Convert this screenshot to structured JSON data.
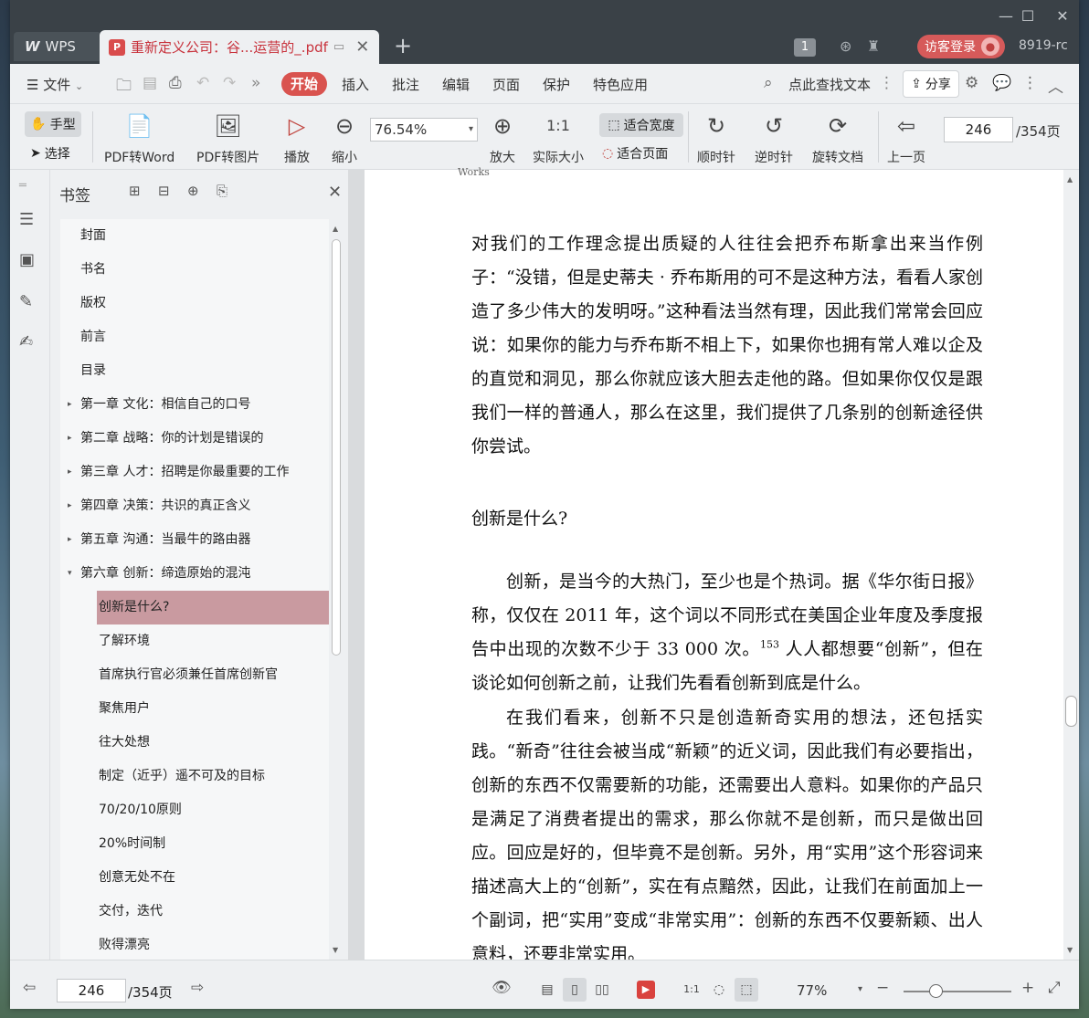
{
  "titlebar": {
    "app_tab": "WPS",
    "doc_tab": "重新定义公司：谷...运营的_.pdf",
    "tab_count": "1",
    "guest_login": "访客登录",
    "version": "8919-rc"
  },
  "menubar": {
    "file": "文件",
    "tabs": [
      "开始",
      "插入",
      "批注",
      "编辑",
      "页面",
      "保护",
      "特色应用"
    ],
    "search": "点此查找文本",
    "share": "分享"
  },
  "toolbar": {
    "hand": "手型",
    "select": "选择",
    "pdf_to_word": "PDF转Word",
    "pdf_to_image": "PDF转图片",
    "play": "播放",
    "zoom_out": "缩小",
    "zoom_value": "76.54%",
    "zoom_in": "放大",
    "actual_size": "实际大小",
    "fit_width": "适合宽度",
    "fit_page": "适合页面",
    "clockwise": "顺时针",
    "counterclockwise": "逆时针",
    "rotate_doc": "旋转文档",
    "prev_page": "上一页",
    "page_current": "246",
    "page_total": "/354页"
  },
  "bookmarks": {
    "title": "书签",
    "items": [
      {
        "label": "封面",
        "level": 0,
        "twisty": ""
      },
      {
        "label": "书名",
        "level": 0,
        "twisty": ""
      },
      {
        "label": "版权",
        "level": 0,
        "twisty": ""
      },
      {
        "label": "前言",
        "level": 0,
        "twisty": ""
      },
      {
        "label": "目录",
        "level": 0,
        "twisty": ""
      },
      {
        "label": "第一章  文化：相信自己的口号",
        "level": 0,
        "twisty": "▸"
      },
      {
        "label": "第二章  战略：你的计划是错误的",
        "level": 0,
        "twisty": "▸"
      },
      {
        "label": "第三章  人才：招聘是你最重要的工作",
        "level": 0,
        "twisty": "▸"
      },
      {
        "label": "第四章  决策：共识的真正含义",
        "level": 0,
        "twisty": "▸"
      },
      {
        "label": "第五章  沟通：当最牛的路由器",
        "level": 0,
        "twisty": "▸"
      },
      {
        "label": "第六章  创新：缔造原始的混沌",
        "level": 0,
        "twisty": "▾"
      },
      {
        "label": "创新是什么?",
        "level": 1,
        "twisty": "",
        "selected": true
      },
      {
        "label": "了解环境",
        "level": 1,
        "twisty": ""
      },
      {
        "label": "首席执行官必须兼任首席创新官",
        "level": 1,
        "twisty": ""
      },
      {
        "label": "聚焦用户",
        "level": 1,
        "twisty": ""
      },
      {
        "label": "往大处想",
        "level": 1,
        "twisty": ""
      },
      {
        "label": "制定（近乎）遥不可及的目标",
        "level": 1,
        "twisty": ""
      },
      {
        "label": "70/20/10原则",
        "level": 1,
        "twisty": ""
      },
      {
        "label": "20%时间制",
        "level": 1,
        "twisty": ""
      },
      {
        "label": "创意无处不在",
        "level": 1,
        "twisty": ""
      },
      {
        "label": "交付，迭代",
        "level": 1,
        "twisty": ""
      },
      {
        "label": "败得漂亮",
        "level": 1,
        "twisty": ""
      }
    ]
  },
  "document": {
    "running_head": "Works",
    "para1": "对我们的工作理念提出质疑的人往往会把乔布斯拿出来当作例子：“没错，但是史蒂夫 · 乔布斯用的可不是这种方法，看看人家创造了多少伟大的发明呀。”这种看法当然有理，因此我们常常会回应说：如果你的能力与乔布斯不相上下，如果你也拥有常人难以企及的直觉和洞见，那么你就应该大胆去走他的路。但如果你仅仅是跟我们一样的普通人，那么在这里，我们提供了几条别的创新途径供你尝试。",
    "heading": "创新是什么?",
    "para2_before": "创新，是当今的大热门，至少也是个热词。据《华尔街日报》称，仅仅在 2011 年，这个词以不同形式在美国企业年度及季度报告中出现的次数不少于 33 000 次。",
    "para2_footnote": "153",
    "para2_after": " 人人都想要“创新”，但在谈论如何创新之前，让我们先看看创新到底是什么。",
    "para3": "在我们看来，创新不只是创造新奇实用的想法，还包括实践。“新奇”往往会被当成“新颖”的近义词，因此我们有必要指出，创新的东西不仅需要新的功能，还需要出人意料。如果你的产品只是满足了消费者提出的需求，那么你就不是创新，而只是做出回应。回应是好的，但毕竟不是创新。另外，用“实用”这个形容词来描述高大上的“创新”，实在有点黯然，因此，让我们在前面加上一个副词，把“实用”变成“非常实用”：创新的东西不仅要新颖、出人意料，还要非常实用。"
  },
  "statusbar": {
    "page_current": "246",
    "page_total": "/354页",
    "zoom": "77%",
    "zoom_fraction": 0.3
  },
  "icons": {
    "minimize": "—",
    "maximize": "☐",
    "close": "✕"
  },
  "colors": {
    "accent": "#d9534f",
    "titlebar": "#3a4147",
    "selected_bookmark": "#c99aa0",
    "doc_tab_title": "#c8323c"
  }
}
